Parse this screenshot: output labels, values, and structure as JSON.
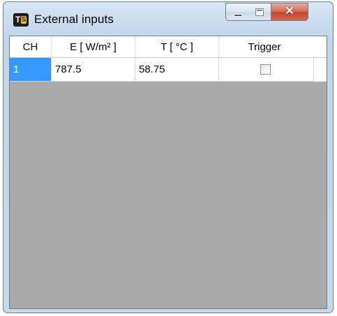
{
  "window": {
    "title": "External inputs",
    "controls": {
      "minimize": "minimize-icon",
      "maximize": "maximize-icon",
      "close": "✕"
    }
  },
  "table": {
    "columns": [
      "CH",
      "E [ W/m² ]",
      "T [ °C ]",
      "Trigger"
    ],
    "rows": [
      {
        "ch": "1",
        "e": "787.5",
        "t": "58.75",
        "trigger": false,
        "selected_column": "ch"
      }
    ]
  },
  "colors": {
    "selection": "#3399ff",
    "empty_area": "#ababab",
    "close_button": "#c4452c"
  }
}
